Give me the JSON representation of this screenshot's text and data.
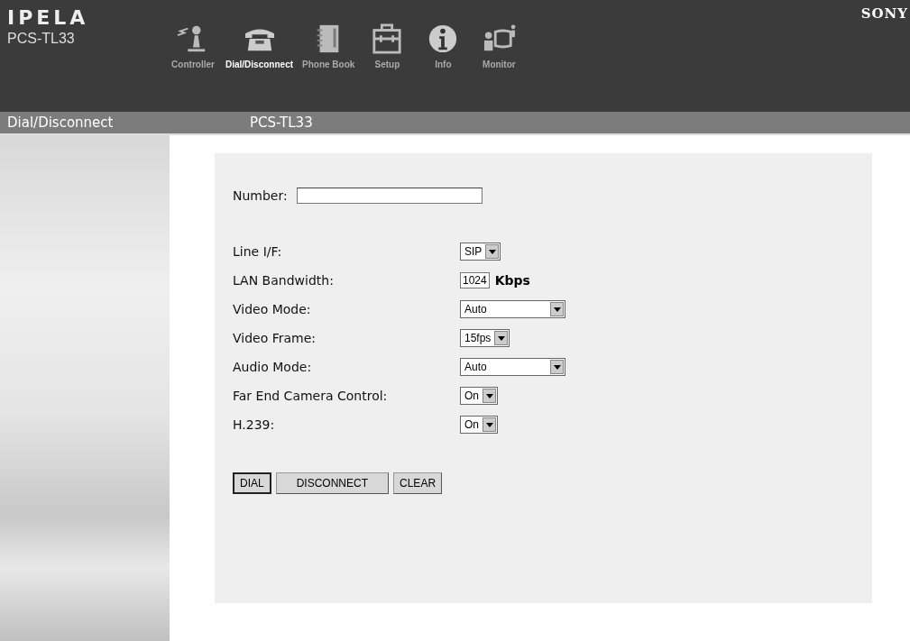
{
  "brand": {
    "logo": "IPELA",
    "model": "PCS-TL33",
    "maker": "SONY"
  },
  "nav": [
    {
      "label": "Controller",
      "kind": "controller",
      "selected": false
    },
    {
      "label": "Dial/Disconnect",
      "kind": "phone",
      "selected": true
    },
    {
      "label": "Phone Book",
      "kind": "book",
      "selected": false
    },
    {
      "label": "Setup",
      "kind": "toolbox",
      "selected": false
    },
    {
      "label": "Info",
      "kind": "info",
      "selected": false
    },
    {
      "label": "Monitor",
      "kind": "monitor",
      "selected": false
    }
  ],
  "title_bar": {
    "page": "Dial/Disconnect",
    "device": "PCS-TL33"
  },
  "number": {
    "label": "Number:"
  },
  "settings": [
    {
      "label": "Line I/F:",
      "kind": "select",
      "value": "SIP"
    },
    {
      "label": "LAN Bandwidth:",
      "kind": "number",
      "value": "1024",
      "unit": "Kbps"
    },
    {
      "label": "Video Mode:",
      "kind": "wide-select",
      "value": "Auto"
    },
    {
      "label": "Video Frame:",
      "kind": "select",
      "value": "15fps"
    },
    {
      "label": "Audio Mode:",
      "kind": "wide-select",
      "value": "Auto"
    },
    {
      "label": "Far End Camera Control:",
      "kind": "select",
      "value": "On"
    },
    {
      "label": "H.239:",
      "kind": "select",
      "value": "On"
    }
  ],
  "buttons": [
    "DIAL",
    "DISCONNECT",
    "CLEAR"
  ]
}
